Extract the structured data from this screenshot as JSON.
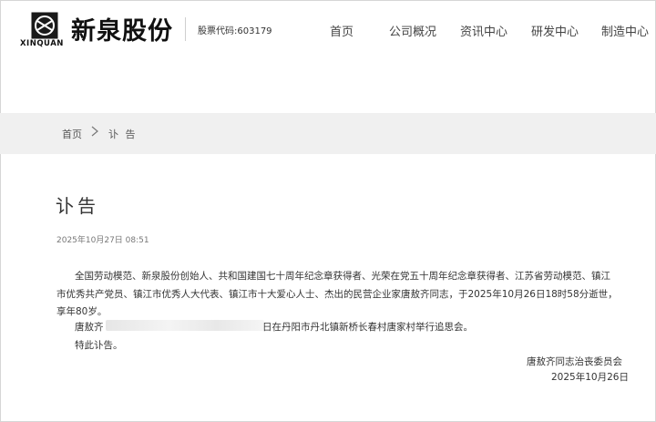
{
  "header": {
    "logo_cn": "新泉股份",
    "logo_en": "XINQUAN",
    "stock_code": "股票代码:603179",
    "nav": [
      "首页",
      "公司概况",
      "资讯中心",
      "研发中心",
      "制造中心"
    ]
  },
  "breadcrumb": {
    "home": "首页",
    "current": "讣 告"
  },
  "article": {
    "title": "讣告",
    "date": "2025年10月27日 08:51",
    "para1_line1": "全国劳动模范、新泉股份创始人、共和国建国七十周年纪念章获得者、光荣在党五十周年纪念章获得者、江苏省劳动模范、镇江",
    "para1_line2": "市优秀共产党员、镇江市优秀人大代表、镇江市十大爱心人士、杰出的民营企业家唐敖齐同志，于2025年10月26日18时58分逝世，",
    "para1_line3": "享年80岁。",
    "para2_start": "唐敖齐",
    "para2_end": "日在丹阳市丹北镇新桥长春村唐家村举行追思会。",
    "para3": "特此讣告。",
    "sign_org": "唐敖齐同志治丧委员会",
    "sign_date": "2025年10月26日"
  }
}
